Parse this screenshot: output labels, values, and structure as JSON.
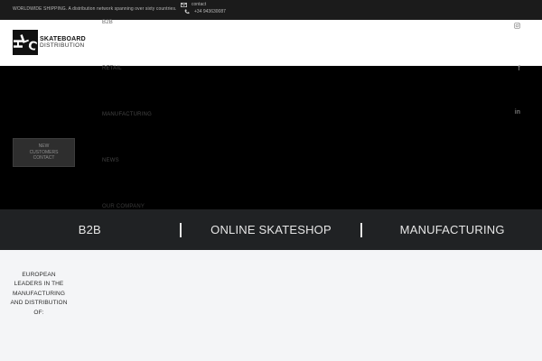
{
  "topbar": {
    "tagline": "WORLDWIDE SHIPPING. A distribution network spanning over sixty countries.",
    "contact_label": "contact",
    "phone": "+34 943630087"
  },
  "header": {
    "logo_line1": "SKATEBOARD",
    "logo_line2": "DISTRIBUTION"
  },
  "nav": {
    "items": [
      {
        "label": "B2B"
      },
      {
        "label": "RETAIL"
      },
      {
        "label": "MANUFACTURING"
      },
      {
        "label": "NEWS"
      },
      {
        "label": "OUR COMPANY"
      }
    ]
  },
  "cta": {
    "line1": "NEW",
    "line2": "CUSTOMERS",
    "line3": "CONTACT"
  },
  "social": {
    "icons": [
      "instagram-icon",
      "facebook-icon",
      "linkedin-icon"
    ],
    "facebook_glyph": "f",
    "linkedin_glyph": "in"
  },
  "categories": [
    {
      "label": "B2B"
    },
    {
      "label": "ONLINE SKATESHOP"
    },
    {
      "label": "MANUFACTURING"
    }
  ],
  "leaders_text": "EUROPEAN LEADERS IN THE MANUFACTURING AND DISTRIBUTION OF:",
  "colors": {
    "topbar": "#1b1b1b",
    "hero": "#000000",
    "category_bar": "#202224",
    "page_bg": "#f4f5f7"
  }
}
